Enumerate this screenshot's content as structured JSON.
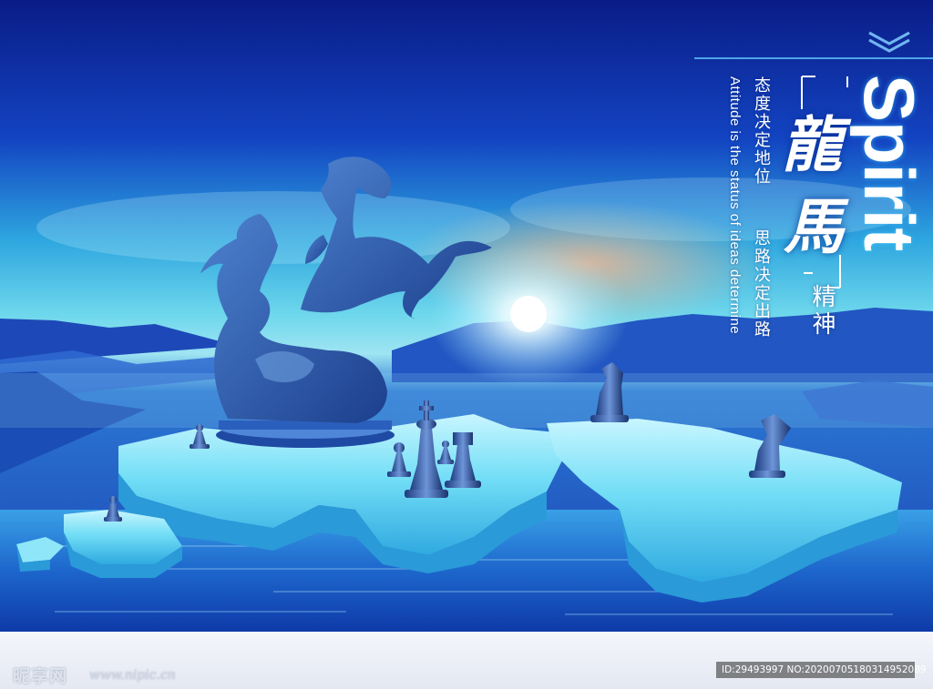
{
  "poster": {
    "slogan_cn_line1": "态度决定地位",
    "slogan_cn_line2": "思路决定出路",
    "slogan_en": "Attitude is the status of ideas determine",
    "title_en": "Spirit",
    "calligraphy_char1": "龍",
    "calligraphy_char2": "馬",
    "title_cn": "精神"
  },
  "watermarks": {
    "site_cn": "昵享网",
    "site_url": "www.nipic.cn",
    "id_text": "ID:29493997 NO:20200705180314952089"
  },
  "colors": {
    "sky_top": "#0b1f8c",
    "horizon_glow": "#3ad0e6",
    "ice_map": "#7fe0f5",
    "water": "#1e6fcf",
    "statue": "#2f5fae"
  }
}
